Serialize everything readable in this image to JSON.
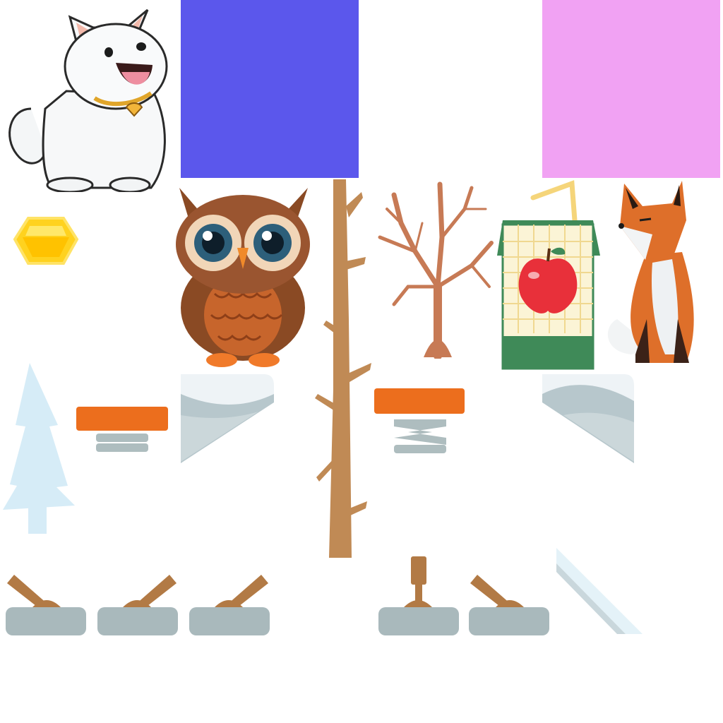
{
  "sheet": {
    "background": "#ffffff",
    "colors": {
      "swatch_blue": "#5b57ec",
      "swatch_pink": "#f1a2f3",
      "platform_orange": "#ec6e1d",
      "spring_gray": "#aebdbf",
      "lever_base": "#a9b9bc",
      "lever_wood": "#b27a45",
      "snow_tree": "#d6ecf7",
      "snow_white": "#eef3f6",
      "wood_brown": "#c08a55",
      "gem_yellow": "#ffd21f"
    },
    "sprites": [
      {
        "name": "samoyed-dog",
        "icon": "dog-icon"
      },
      {
        "name": "blue-swatch",
        "icon": "color-block"
      },
      {
        "name": "pink-swatch",
        "icon": "color-block"
      },
      {
        "name": "yellow-gem",
        "icon": "gem-icon"
      },
      {
        "name": "brown-owl",
        "icon": "owl-icon"
      },
      {
        "name": "bare-trunk",
        "icon": "trunk-icon"
      },
      {
        "name": "bare-tree",
        "icon": "tree-icon"
      },
      {
        "name": "apple-juice-box",
        "icon": "juice-box-icon"
      },
      {
        "name": "red-fox",
        "icon": "fox-icon"
      },
      {
        "name": "snowy-pine",
        "icon": "pine-icon"
      },
      {
        "name": "orange-spring-platform",
        "icon": "spring-icon",
        "state": "compressed"
      },
      {
        "name": "orange-spring-platform",
        "icon": "spring-icon",
        "state": "extended"
      },
      {
        "name": "snow-slope",
        "icon": "slope-icon"
      },
      {
        "name": "lever",
        "icon": "lever-icon",
        "state": "left"
      },
      {
        "name": "lever",
        "icon": "lever-icon",
        "state": "right"
      },
      {
        "name": "lever",
        "icon": "lever-icon",
        "state": "up"
      },
      {
        "name": "ice-ramp",
        "icon": "ramp-icon"
      }
    ]
  }
}
